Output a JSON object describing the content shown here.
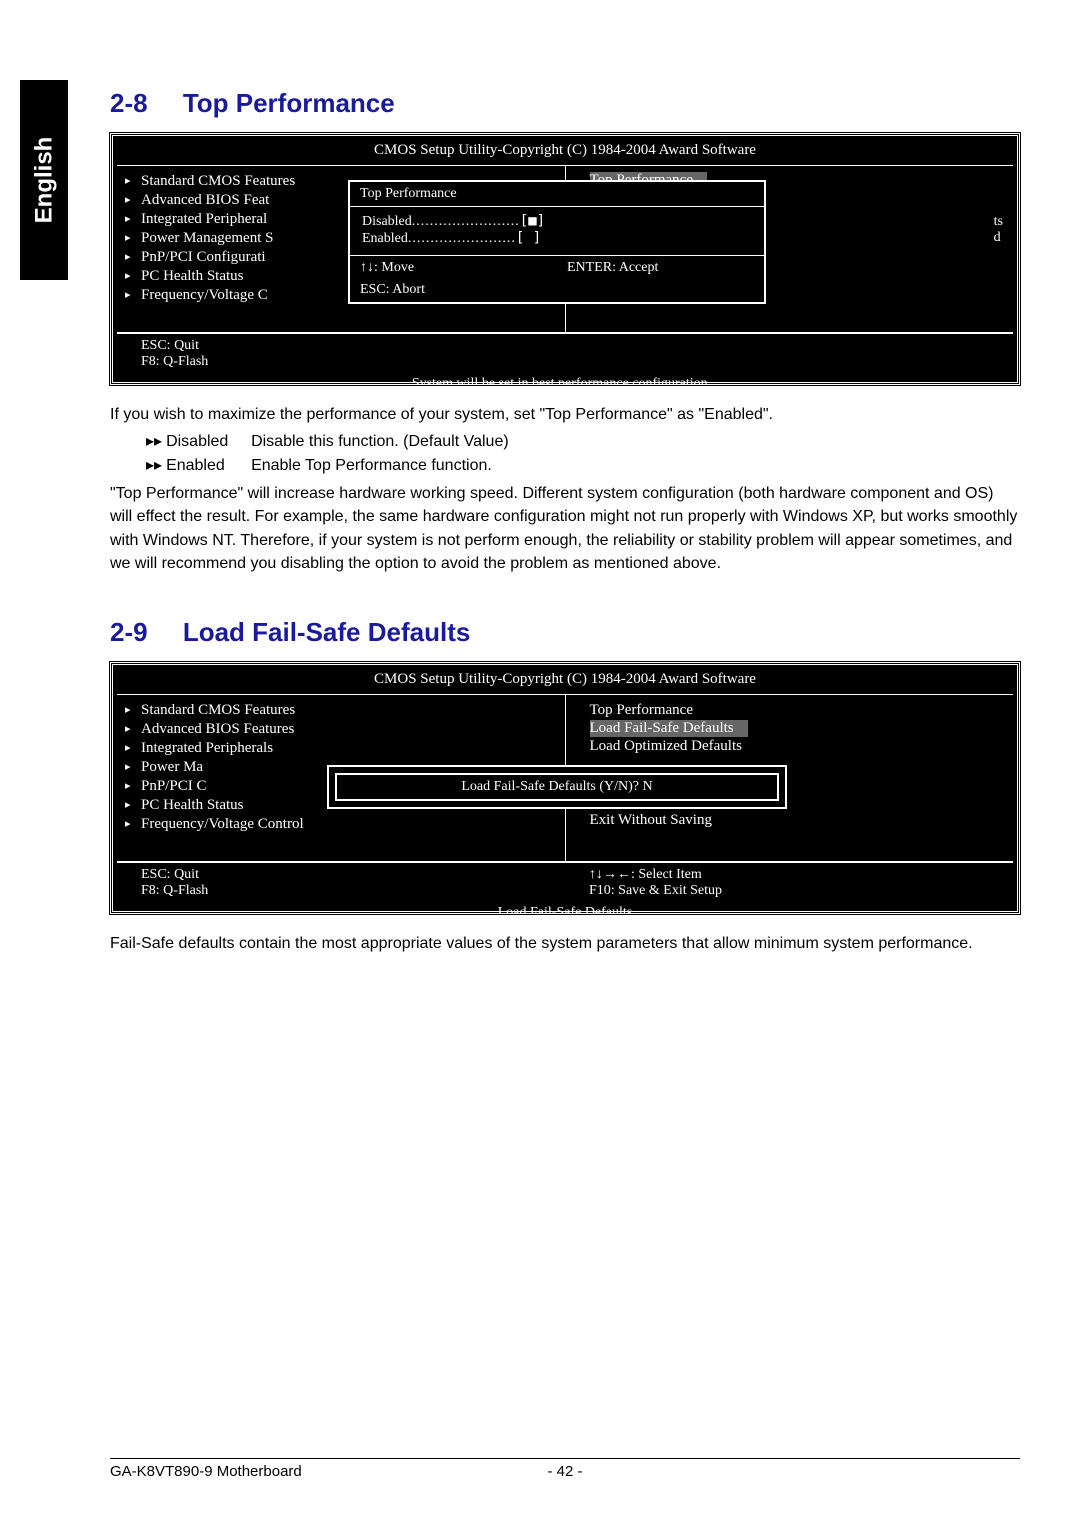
{
  "lang_tab": "English",
  "section_28": {
    "num": "2-8",
    "title": "Top Performance"
  },
  "section_29": {
    "num": "2-9",
    "title": "Load Fail-Safe Defaults"
  },
  "bios_title": "CMOS Setup Utility-Copyright (C) 1984-2004 Award Software",
  "bios1": {
    "left_items": [
      "Standard CMOS Features",
      "Advanced BIOS Feat",
      "Integrated Peripheral",
      "Power Management S",
      "PnP/PCI Configurati",
      "PC Health Status",
      "Frequency/Voltage C"
    ],
    "right_highlight": "Top Performance",
    "right_frag1": "ts",
    "right_frag2": "d",
    "bottom_left_1": "ESC: Quit",
    "bottom_left_2": "F8: Q-Flash",
    "popup_title": "Top Performance",
    "popup_opt1": "Disabled",
    "popup_opt1_mark": "[■]",
    "popup_opt2": "Enabled",
    "popup_opt2_mark": "[   ]",
    "popup_foot_left1": "↑↓: Move",
    "popup_foot_right": "ENTER: Accept",
    "popup_foot_left2": "ESC: Abort",
    "footer_msg": "System will be set in best performance configuration .."
  },
  "body_28": {
    "p1": "If you wish to maximize the performance of your system, set \"Top Performance\" as \"Enabled\".",
    "opt1_label": "Disabled",
    "opt1_text": "Disable this function. (Default Value)",
    "opt2_label": "Enabled",
    "opt2_text": "Enable Top Performance function.",
    "p2": "\"Top Performance\" will increase hardware working speed. Different system configuration (both hardware component and OS) will effect the result. For example, the same hardware configuration might not run properly with Windows XP, but works smoothly with Windows NT.  Therefore, if your system is not perform enough, the reliability or stability problem will appear sometimes, and we will recommend you disabling the option to avoid the problem as mentioned above."
  },
  "bios2": {
    "left_items": [
      "Standard CMOS Features",
      "Advanced BIOS Features",
      "Integrated Peripherals",
      "Power Ma",
      "PnP/PCI C",
      "PC Health Status",
      "Frequency/Voltage Control"
    ],
    "right_items": [
      "Top Performance",
      "Load Fail-Safe Defaults",
      "Load Optimized Defaults",
      "",
      "",
      "Save & Exit Setup",
      "Exit Without Saving"
    ],
    "right_highlight_idx": 1,
    "popup_text": "Load Fail-Safe Defaults (Y/N)? N",
    "bottom_left_1": "ESC: Quit",
    "bottom_left_2": "F8: Q-Flash",
    "bottom_right_1": "↑↓→←: Select Item",
    "bottom_right_2": "F10: Save & Exit Setup",
    "footer_msg": "Load Fail-Safe Defaults"
  },
  "body_29": {
    "p1": "Fail-Safe defaults contain the most appropriate values of the system parameters that allow minimum system performance."
  },
  "footer": {
    "left": "GA-K8VT890-9 Motherboard",
    "page": "- 42 -"
  },
  "icons": {
    "arrow": "▸▸"
  }
}
